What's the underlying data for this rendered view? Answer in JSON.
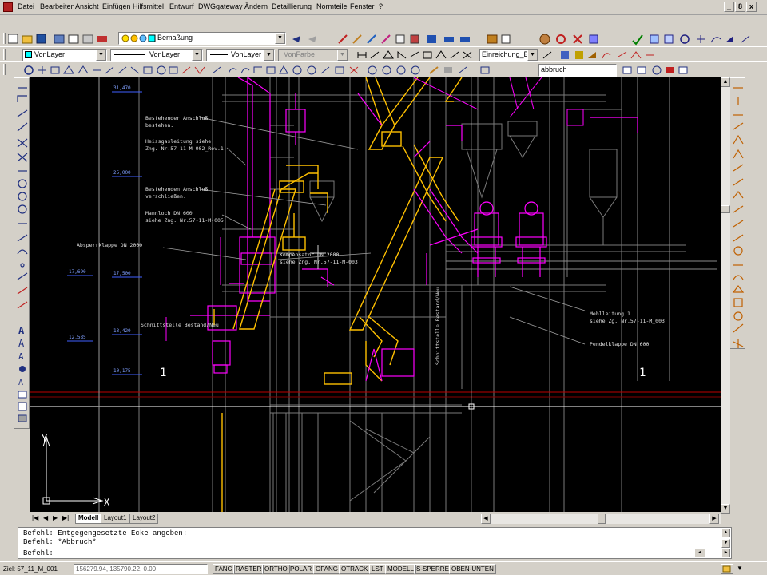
{
  "menubar": {
    "items": [
      "Datei",
      "Bearbeiten",
      "Ansicht",
      "Einfügen",
      "Hilfsmittel",
      "Entwurf",
      "DWGgateway",
      "Ändern",
      "Detaillierung",
      "Normteile",
      "Fenster",
      "?"
    ],
    "window_controls": [
      "_",
      "8",
      "x"
    ]
  },
  "toolbar": {
    "dimstyle": "Bemaßung",
    "layer": "VonLayer",
    "linetype1": "VonLayer",
    "linetype2": "VonLayer",
    "color": "VonFarbe",
    "dimension": "Einreichung_BA",
    "command_box": "abbruch"
  },
  "drawing": {
    "elevations": [
      "31,470",
      "25,000",
      "17,690",
      "17,500",
      "13,420",
      "12,585",
      "10,175"
    ],
    "annotations": {
      "a1": "Bestehender Anschluß",
      "a1b": "bestehen.",
      "a2": "Heissgasleitung siehe",
      "a2b": "Zng. Nr.57-11-M-002_Rev.1",
      "a3": "Bestehenden Anschluß",
      "a3b": "verschließen.",
      "a4": "Mannloch DN 600",
      "a4b": "siehe Zng. Nr.57-11-M-005",
      "a5": "Absperrklappe DN 2000",
      "a6": "Kompensator DN 2000",
      "a6b": "siehe Zng. Nr.57-11-M-003",
      "a7": "Schnittstelle Bestand/Neu",
      "a8": "Schnittstelle Bestand/Neu",
      "a9": "Mehlleitung 1",
      "a9b": "siehe Zg. Nr.57-11-M_003",
      "a10": "Pendelklappe DN 600",
      "sec_left": "1",
      "sec_right": "1"
    },
    "ucs": {
      "x": "X",
      "y": "Y"
    }
  },
  "layout_tabs": [
    "Modell",
    "Layout1",
    "Layout2"
  ],
  "command": {
    "line1": "Befehl: Entgegengesetzte Ecke angeben:",
    "line2": "Befehl: *Abbruch*",
    "line3": "Befehl:"
  },
  "status": {
    "target": "Ziel: 57_11_M_001",
    "coords": "156279.94, 135790.22, 0.00",
    "toggles": [
      "FANG",
      "RASTER",
      "ORTHO",
      "POLAR",
      "OFANG",
      "OTRACK",
      "LST",
      "MODELL",
      "S-SPERRE",
      "OBEN-UNTEN"
    ]
  },
  "colors": {
    "magenta": "#ff00ff",
    "yellow": "#ffc000",
    "white": "#ffffff",
    "red": "#c00000",
    "gray": "#9a9a9a"
  }
}
